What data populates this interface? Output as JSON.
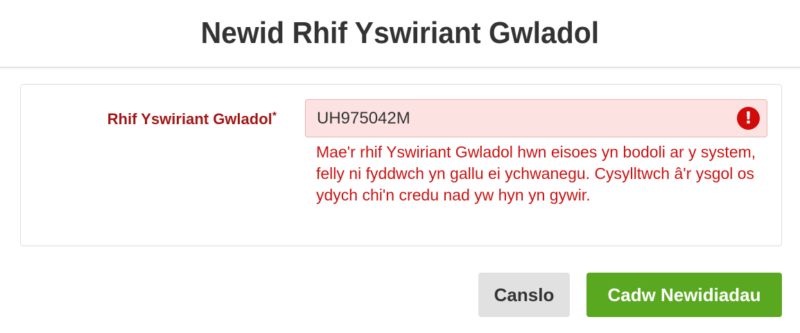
{
  "dialog": {
    "title": "Newid Rhif Yswiriant Gwladol"
  },
  "form": {
    "field_label": "Rhif Yswiriant Gwladol",
    "required_marker": "*",
    "input_value": "UH975042M",
    "error_icon": "!",
    "error_message": "Mae'r rhif Yswiriant Gwladol hwn eisoes yn bodoli ar y system, felly ni fyddwch yn gallu ei ychwanegu. Cysylltwch â'r ysgol os ydych chi'n credu nad yw hyn yn gywir."
  },
  "actions": {
    "cancel_label": "Canslo",
    "save_label": "Cadw Newidiadau"
  },
  "colors": {
    "label_error": "#a31717",
    "error_text": "#cc1212",
    "input_error_bg": "#fde2e2",
    "error_icon": "#d10a0a",
    "save_button": "#5aa81f",
    "cancel_button": "#e1e1e1"
  }
}
